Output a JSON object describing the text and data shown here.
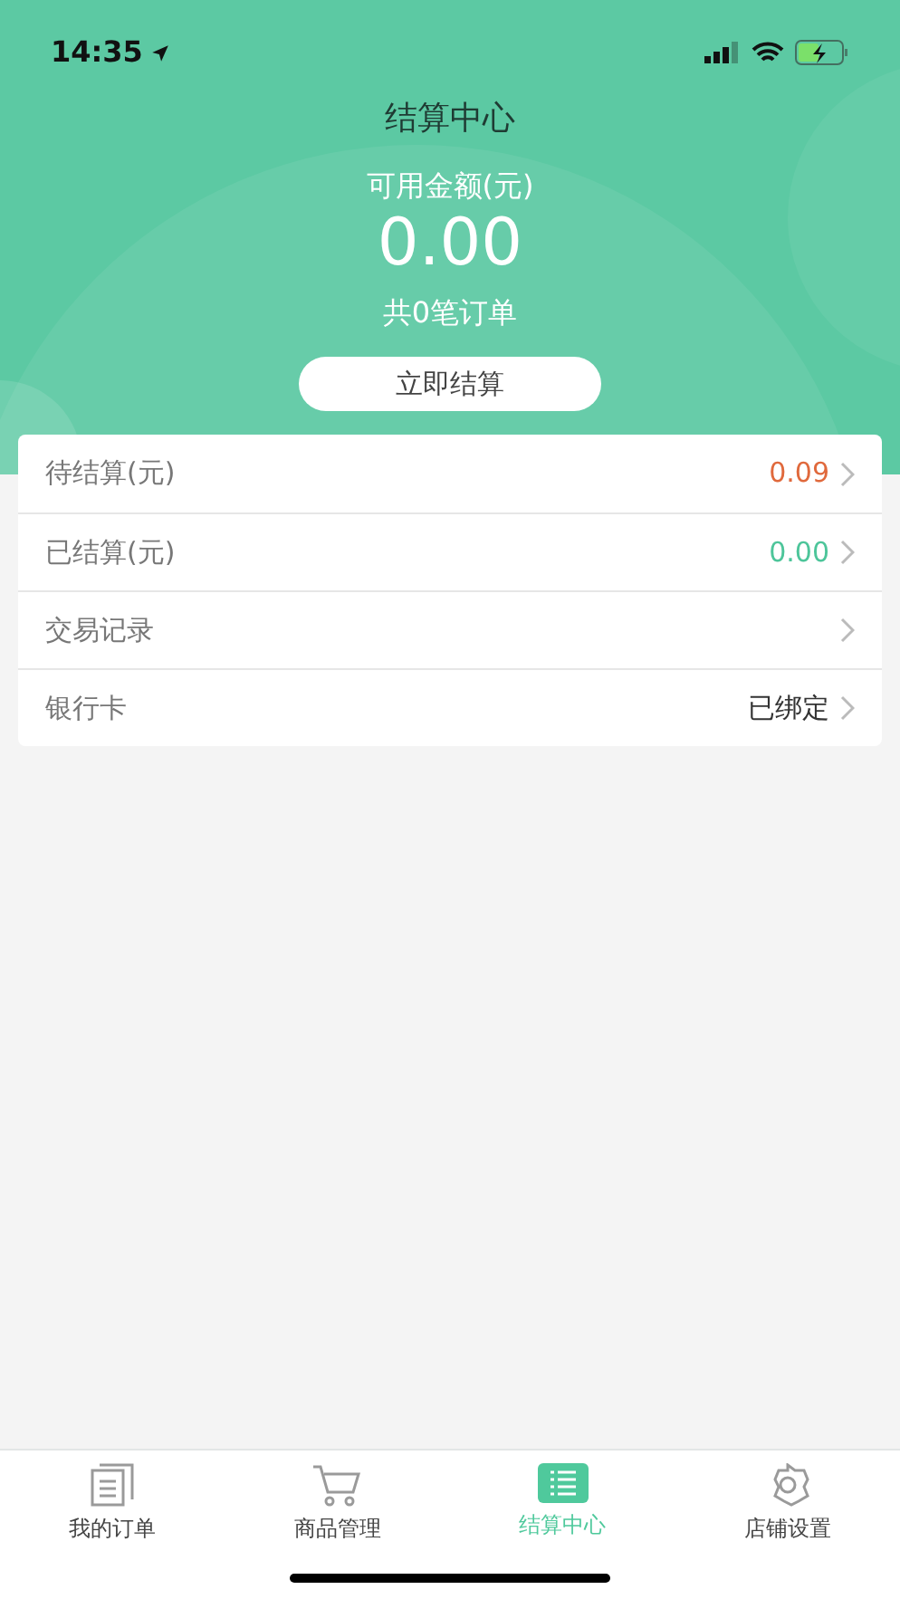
{
  "status_bar": {
    "time": "14:35"
  },
  "header": {
    "title": "结算中心",
    "balance_label": "可用金额(元)",
    "balance": "0.00",
    "order_count": "共0笔订单",
    "settle_button": "立即结算"
  },
  "rows": [
    {
      "label": "待结算(元)",
      "value": "0.09",
      "color": "#e0693c"
    },
    {
      "label": "已结算(元)",
      "value": "0.00",
      "color": "#4dc59a"
    },
    {
      "label": "交易记录"
    },
    {
      "label": "银行卡",
      "value": "已绑定",
      "color": "#333333"
    }
  ],
  "tab_bar": [
    {
      "label": "我的订单",
      "selected": false
    },
    {
      "label": "商品管理",
      "selected": false
    },
    {
      "label": "结算中心",
      "selected": true
    },
    {
      "label": "店铺设置",
      "selected": false
    }
  ]
}
